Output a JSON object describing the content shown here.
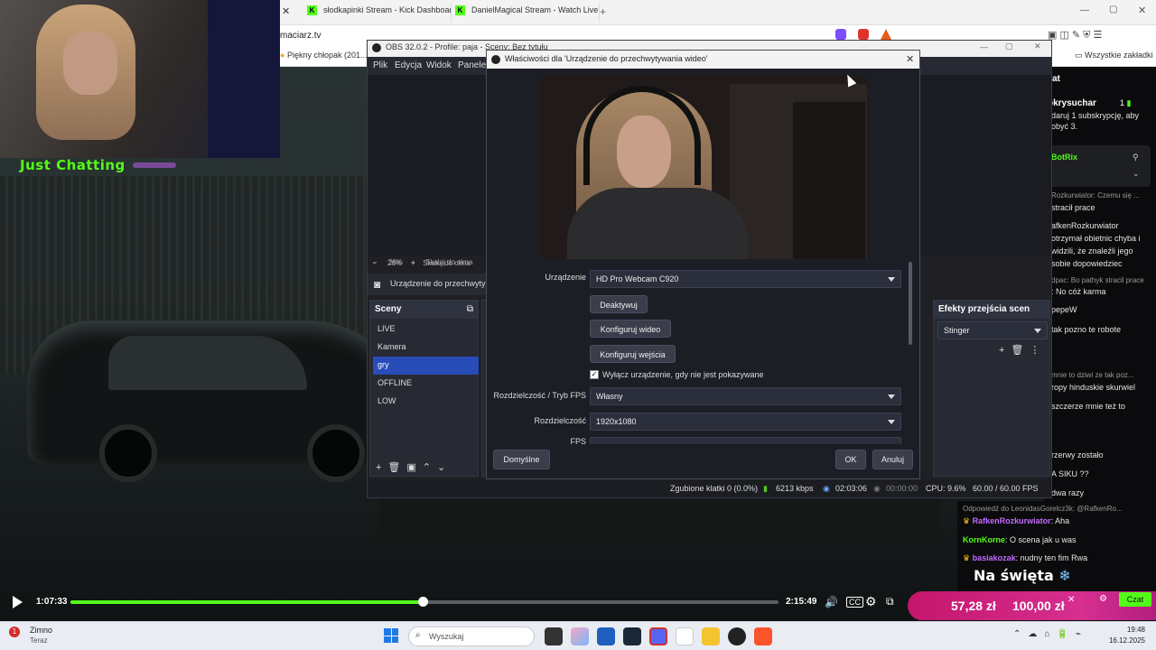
{
  "stream": {
    "category_overlay": "Just Chatting",
    "current_time": "1:07:33",
    "duration": "2:15:49",
    "progress": 0.497
  },
  "browser": {
    "tabs": [
      {
        "label": "słodkapinki Stream - Kick Dashboard"
      },
      {
        "label": "DanielMagical Stream - Watch Live o"
      }
    ],
    "address": "maciarz.tv",
    "bookmark": "Piękny chłopak (201...",
    "all_bookmarks": "Wszystkie zakładki"
  },
  "chat": {
    "title": "zat",
    "first_user": "okrysuchar",
    "first_badge": "1",
    "first_lines": [
      "daruj 1 subskrypcję, aby",
      "obyć 3."
    ],
    "pinned_user": "BotRix",
    "messages": [
      "Rozkurwiator: Czemu się ...",
      "stracił prace",
      "afkenRozkurwiator",
      "otrzymał obietnic chyba i",
      "widzili, że znaleźli jego",
      "sobie dopowiedziec",
      "dpac: Bo pathyk stracil prace",
      ": No cóż karma",
      "pepeW",
      "tak pozno te robote",
      "mnie to dziwi ze tak poz...",
      "ropy hinduskie skurwiel",
      "szczerze mnie też to",
      "rzerwy zostało",
      "A SIKU ??",
      "dwa razy"
    ],
    "reply_header": "Odpowiedź do LeonidasGorelcz3k: @RafkenRo...",
    "bottom_messages": [
      {
        "user": "RafkenRozkurwiator",
        "text": ": Aha"
      },
      {
        "user": "KornKorne",
        "text": ": O scena jak u was"
      },
      {
        "user": "basiakozak",
        "text": ": nudny ten fim Rwa"
      }
    ],
    "banner": "Na święta",
    "chat_button": "Czat"
  },
  "donation": {
    "amount1": "57,28 zł",
    "amount2": "100,00 zł"
  },
  "obs": {
    "title": "OBS 32.0.2 - Profile: paja - Sceny: Bez tytułu",
    "menu": [
      "Plik",
      "Edycja",
      "Widok",
      "Panele"
    ],
    "zoom": "26%",
    "fit_label": "Skaluj do okna",
    "source_bar_label": "Urządzenie do przechwyty",
    "scenes_title": "Sceny",
    "scenes": [
      "LIVE",
      "Kamera",
      "gry",
      "OFFLINE",
      "LOW"
    ],
    "selected_scene": "gry",
    "transitions_title": "Efekty przejścia scen",
    "transition": "Stinger",
    "status": {
      "dropped": "Zgubione klatki 0 (0.0%)",
      "bitrate": "6213 kbps",
      "live_time": "02:03:06",
      "rec_time": "00:00:00",
      "cpu": "CPU: 9.6%",
      "fps": "60.00 / 60.00 FPS"
    }
  },
  "dialog": {
    "title": "Właściwości dla 'Urządzenie do przechwytywania wideo'",
    "zoom": "26%",
    "fit_label": "Skaluj do okna",
    "device_label": "Urządzenie",
    "device_value": "HD Pro Webcam C920",
    "deactivate": "Deaktywuj",
    "configure_video": "Konfiguruj wideo",
    "configure_input": "Konfiguruj wejścia",
    "checkbox_label": "Wyłącz urządzenie, gdy nie jest pokazywane",
    "resfps_label": "Rozdzielczość / Tryb FPS",
    "resfps_value": "Własny",
    "res_label": "Rozdzielczość",
    "res_value": "1920x1080",
    "fps_label": "FPS",
    "defaults": "Domyślne",
    "ok": "OK",
    "cancel": "Anuluj"
  },
  "notification": {
    "title": "Zimno",
    "sub": "Teraz",
    "badge": "1"
  },
  "taskbar": {
    "search": "Wyszukaj",
    "time": "19:48",
    "date": "16.12.2025"
  }
}
